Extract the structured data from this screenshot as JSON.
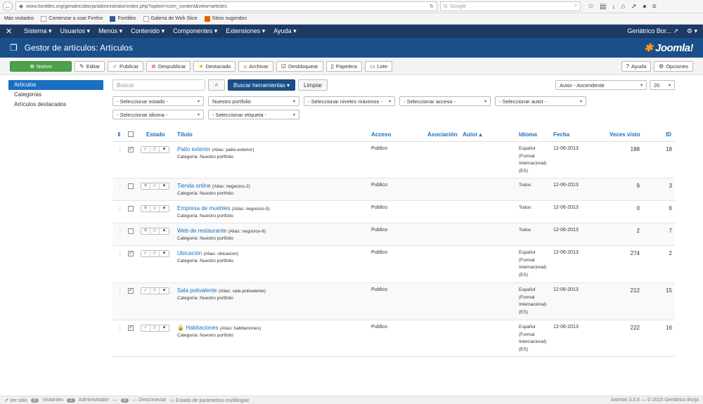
{
  "browser": {
    "url": "www.fontilles.org/geriatricoborja/administrator/index.php?option=com_content&view=articles",
    "search_engine": "Google",
    "bookmarks": [
      "Más visitados",
      "Comenzar a usar Firefox",
      "Fontilles",
      "Galería de Web Slice",
      "Sitios sugeridos"
    ]
  },
  "topnav": {
    "menus": [
      "Sistema ▾",
      "Usuarios ▾",
      "Menús ▾",
      "Contenido ▾",
      "Componentes ▾",
      "Extensiones ▾",
      "Ayuda ▾"
    ],
    "site": "Geriátrico Bor...",
    "settings": "⚙ ▾"
  },
  "header": {
    "title": "Gestor de artículos: Artículos",
    "brand": "Joomla!"
  },
  "toolbar": {
    "new": "Nuevo",
    "edit": "Editar",
    "publish": "Publicar",
    "unpublish": "Despublicar",
    "featured": "Destacado",
    "archive": "Archivar",
    "checkin": "Desbloquear",
    "trash": "Papelera",
    "batch": "Lote",
    "help": "Ayuda",
    "options": "Opciones"
  },
  "sidebar": [
    "Artículos",
    "Categorías",
    "Artículos destacados"
  ],
  "search": {
    "placeholder": "Buscar",
    "tools": "Buscar herramientas ▾",
    "clear": "Limpiar",
    "order": "Autor - Ascendente",
    "limit": "20"
  },
  "filters": {
    "status": "- Seleccionar estado -",
    "category": "Nuestro portfolio",
    "levels": "- Seleccionar niveles máximos -",
    "access": "- Seleccionar acceso -",
    "author": "- Seleccionar autor -",
    "language": "- Seleccionar idioma -",
    "tag": "- Seleccionar etiqueta -"
  },
  "columns": {
    "sort": "⇕",
    "status": "Estado",
    "title": "Título",
    "access": "Acceso",
    "association": "Asociación",
    "author": "Autor ▴",
    "language": "Idioma",
    "date": "Fecha",
    "hits": "Veces visto",
    "id": "ID"
  },
  "rows": [
    {
      "checked": "✓",
      "state": "✓",
      "title": "Patio exterior",
      "alias": "(Alias: patio-exterior)",
      "category": "Categoría: Nuestro portfolio",
      "access": "Publico",
      "language": "Español (Formal Internacional) (ES)",
      "date": "12-06-2013",
      "hits": "188",
      "id": "18",
      "locked": ""
    },
    {
      "checked": "",
      "state": "✕",
      "title": "Tienda online",
      "alias": "(Alias: negocios-2)",
      "category": "Categoría: Nuestro portfolio",
      "access": "Publico",
      "language": "Todos",
      "date": "12-06-2013",
      "hits": "9",
      "id": "3",
      "locked": ""
    },
    {
      "checked": "",
      "state": "✕",
      "title": "Empresa de muebles",
      "alias": "(Alias: negocios-5)",
      "category": "Categoría: Nuestro portfolio",
      "access": "Publico",
      "language": "Todos",
      "date": "12-06-2013",
      "hits": "0",
      "id": "6",
      "locked": ""
    },
    {
      "checked": "",
      "state": "✕",
      "title": "Web de restaurante",
      "alias": "(Alias: negocios-6)",
      "category": "Categoría: Nuestro portfolio",
      "access": "Publico",
      "language": "Todos",
      "date": "12-06-2013",
      "hits": "2",
      "id": "7",
      "locked": ""
    },
    {
      "checked": "✓",
      "state": "✓",
      "title": "Ubicación",
      "alias": "(Alias: ubicacion)",
      "category": "Categoría: Nuestro portfolio",
      "access": "Publico",
      "language": "Español (Formal Internacional) (ES)",
      "date": "12-06-2013",
      "hits": "274",
      "id": "2",
      "locked": ""
    },
    {
      "checked": "✓",
      "state": "✓",
      "title": "Sala polivalente",
      "alias": "(Alias: sala-polivalente)",
      "category": "Categoría: Nuestro portfolio",
      "access": "Publico",
      "language": "Español (Formal Internacional) (ES)",
      "date": "12-06-2013",
      "hits": "212",
      "id": "15",
      "locked": ""
    },
    {
      "checked": "✓",
      "state": "✓",
      "title": "Habitaciones",
      "alias": "(Alias: habitaciones)",
      "category": "Categoría: Nuestro portfolio",
      "access": "Publico",
      "language": "Español (Formal Internacional) (ES)",
      "date": "12-06-2013",
      "hits": "222",
      "id": "16",
      "locked": "🔒"
    }
  ],
  "footer": {
    "view_site": "Ver sitio",
    "visitors_count": "0",
    "visitors": "Visitantes",
    "admin_count": "1",
    "admin": "Administrador",
    "messages_count": "0",
    "logout": "Desconectar",
    "multilang": "Estado de parámetros multilingüe",
    "version": "Joomla! 3.3.6 — © 2015 Geriátrico Borja"
  }
}
